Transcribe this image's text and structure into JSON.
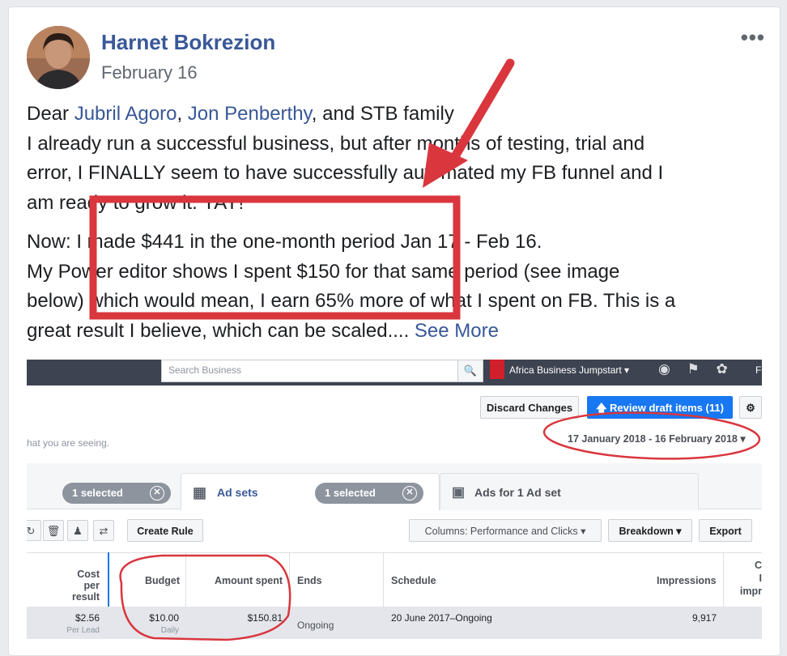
{
  "post": {
    "author": "Harnet Bokrezion",
    "date": "February 16",
    "more": "•••",
    "p1": {
      "s1": "Dear ",
      "link1": "Jubril Agoro",
      "s2": ", ",
      "link2": "Jon Penberthy",
      "s3": ", and STB family",
      "l2": "I already run a successful business, but after months of testing, trial and",
      "l3": "error, I FINALLY seem to have successfully automated my FB funnel and I",
      "l4": "am ready to grow it. YAY!"
    },
    "p2": {
      "l1": "Now: I made $441 in the one-month period Jan 17 - Feb 16.",
      "l2": "My Power editor shows I spent $150 for that same period (see image",
      "l3": "below) which would mean, I earn 65% more of what I spent on FB. This is a",
      "l4": "great result I believe, which can be scaled.... ",
      "see_more": "See More"
    }
  },
  "screenshot": {
    "search_placeholder": "Search Business",
    "account": "Africa Business Jumpstart ▾",
    "top_icons": "◉ ⚑ ✿",
    "top_letter": "F",
    "discard": "Discard Changes",
    "review": "🡅 Review draft items (11)",
    "gear": "⚙",
    "hint": "hat you are seeing.",
    "date_range": "17 January 2018 - 16 February 2018 ▾",
    "pill1": "1 selected",
    "pill1_x": "✕",
    "tab_adsets": "Ad sets",
    "pill2": "1 selected",
    "pill2_x": "✕",
    "tab_ads": "Ads for 1 Ad set",
    "create_rule": "Create Rule",
    "columns": "Columns: Performance and Clicks ▾",
    "breakdown": "Breakdown ▾",
    "export": "Export",
    "headers": {
      "cost_per_result_1": "Cost per",
      "cost_per_result_2": "result",
      "budget": "Budget",
      "amount_spent": "Amount spent",
      "ends": "Ends",
      "schedule": "Schedule",
      "impressions": "Impressions",
      "clipped_1": "C",
      "clipped_2": "I",
      "clipped_3": "impr"
    },
    "row": {
      "cost": "$2.56",
      "cost_sub": "Per Lead",
      "budget": "$10.00",
      "budget_sub": "Daily",
      "amount_spent": "$150.81",
      "ends": "Ongoing",
      "schedule": "20 June 2017–Ongoing",
      "impressions": "9,917"
    }
  },
  "colors": {
    "link": "#385898",
    "annotation_red": "#d9363e"
  }
}
